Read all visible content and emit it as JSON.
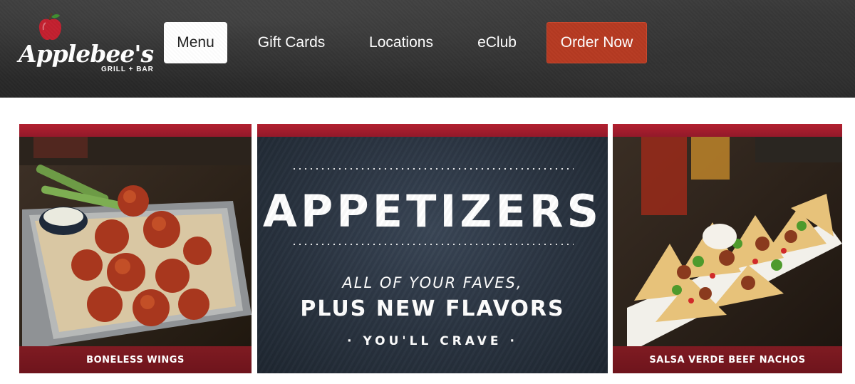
{
  "brand": {
    "name": "Applebee's",
    "subtitle": "GRILL + BAR",
    "icon": "apple-icon"
  },
  "nav": {
    "items": [
      {
        "label": "Menu",
        "active": true
      },
      {
        "label": "Gift Cards"
      },
      {
        "label": "Locations"
      },
      {
        "label": "eClub"
      },
      {
        "label": "Order Now",
        "highlight": true
      }
    ]
  },
  "promo": {
    "left": {
      "caption": "BONELESS WINGS"
    },
    "center": {
      "headline": "APPETIZERS",
      "line1": "ALL OF YOUR FAVES,",
      "line2": "PLUS NEW FLAVORS",
      "line3": "· YOU'LL CRAVE ·"
    },
    "right": {
      "caption": "SALSA VERDE BEEF NACHOS"
    }
  },
  "colors": {
    "header_bg": "#2e2e2e",
    "order_button": "#b63a22",
    "brand_red": "#a21e2c",
    "caption_bar": "#741820",
    "chalkboard": "#2a3441"
  }
}
